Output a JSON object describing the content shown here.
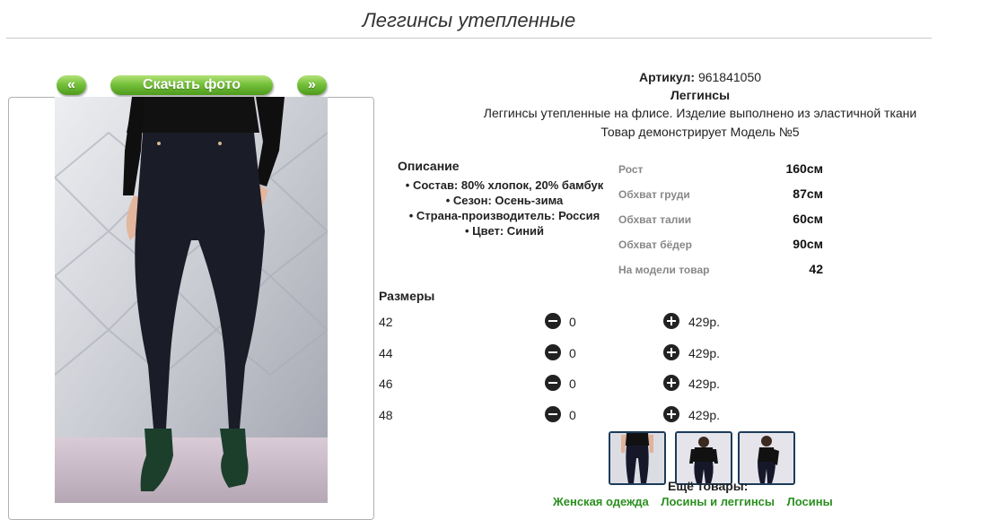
{
  "product": {
    "title": "Леггинсы утепленные",
    "article_label": "Артикул:",
    "article_value": "961841050",
    "name": "Леггинсы",
    "short_description": "Леггинсы утепленные на флисе. Изделие выполнено из эластичной ткани",
    "model_note": "Товар демонстрирует Модель №5"
  },
  "gallery": {
    "prev_label": "«",
    "download_label": "Скачать фото",
    "next_label": "»"
  },
  "description": {
    "heading": "Описание",
    "items": [
      "Состав: 80% хлопок, 20% бамбук",
      "Сезон: Осень-зима",
      "Страна-производитель: Россия",
      "Цвет: Синий"
    ]
  },
  "model_measurements": [
    {
      "label": "Рост",
      "value": "160см"
    },
    {
      "label": "Обхват груди",
      "value": "87см"
    },
    {
      "label": "Обхват талии",
      "value": "60см"
    },
    {
      "label": "Обхват бёдер",
      "value": "90см"
    },
    {
      "label": "На модели товар",
      "value": "42"
    }
  ],
  "sizes": {
    "heading": "Размеры",
    "rows": [
      {
        "size": "42",
        "quantity": "0",
        "price": "429р."
      },
      {
        "size": "44",
        "quantity": "0",
        "price": "429р."
      },
      {
        "size": "46",
        "quantity": "0",
        "price": "429р."
      },
      {
        "size": "48",
        "quantity": "0",
        "price": "429р."
      }
    ]
  },
  "more": {
    "heading": "Ещё товары:",
    "links": [
      "Женская одежда",
      "Лосины и леггинсы",
      "Лосины"
    ]
  },
  "colors": {
    "accent_green": "#76c13b",
    "link_green": "#2a8f1f",
    "thumb_border": "#1d3b5a"
  }
}
